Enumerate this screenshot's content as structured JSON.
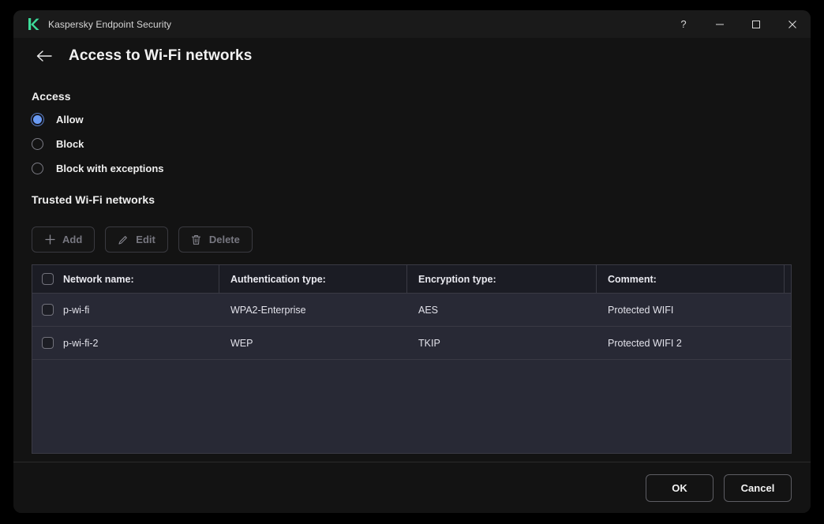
{
  "titlebar": {
    "logo_icon": "kaspersky-k-logo",
    "app_title": "Kaspersky Endpoint Security",
    "help_label": "?",
    "minimize_label": "–",
    "maximize_label": "☐",
    "close_label": "✕"
  },
  "header": {
    "back_icon": "arrow-left-icon",
    "page_title": "Access to Wi-Fi networks"
  },
  "access": {
    "section_title": "Access",
    "options": [
      {
        "label": "Allow",
        "selected": true
      },
      {
        "label": "Block",
        "selected": false
      },
      {
        "label": "Block with exceptions",
        "selected": false
      }
    ]
  },
  "trusted": {
    "section_title": "Trusted Wi-Fi networks",
    "toolbar": [
      {
        "label": "Add",
        "icon": "plus-icon"
      },
      {
        "label": "Edit",
        "icon": "pencil-icon"
      },
      {
        "label": "Delete",
        "icon": "trash-icon"
      }
    ],
    "table": {
      "columns": [
        "Network name:",
        "Authentication type:",
        "Encryption type:",
        "Comment:"
      ],
      "rows": [
        {
          "checked": false,
          "network_name": "p-wi-fi",
          "authentication_type": "WPA2-Enterprise",
          "encryption_type": "AES",
          "comment": "Protected WIFI"
        },
        {
          "checked": false,
          "network_name": "p-wi-fi-2",
          "authentication_type": "WEP",
          "encryption_type": "TKIP",
          "comment": "Protected WIFI 2"
        }
      ]
    }
  },
  "footer": {
    "ok_label": "OK",
    "cancel_label": "Cancel"
  },
  "colors": {
    "accent_green": "#3ddc9a",
    "radio_blue": "#6a9bf4",
    "window_bg": "#131313",
    "table_header_bg": "#1b1c24",
    "table_row_bg": "#282935"
  }
}
